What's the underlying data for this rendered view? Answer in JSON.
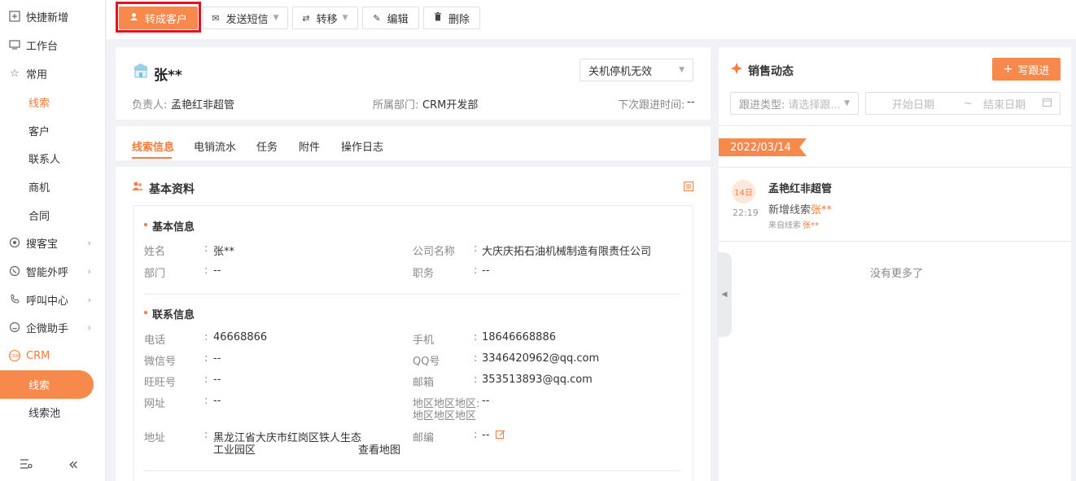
{
  "sidebar": {
    "items": [
      {
        "label": "快捷新增",
        "icon": "add-icon"
      },
      {
        "label": "工作台",
        "icon": "monitor-icon"
      },
      {
        "label": "常用",
        "icon": "star-icon"
      },
      {
        "label": "线索"
      },
      {
        "label": "客户"
      },
      {
        "label": "联系人"
      },
      {
        "label": "商机"
      },
      {
        "label": "合同"
      },
      {
        "label": "搜客宝",
        "icon": "search-icon"
      },
      {
        "label": "智能外呼",
        "icon": "phone-icon"
      },
      {
        "label": "呼叫中心",
        "icon": "call-center-icon"
      },
      {
        "label": "企微助手",
        "icon": "wechat-work-icon"
      },
      {
        "label": "CRM",
        "icon": "crm-icon"
      },
      {
        "label": "线索"
      },
      {
        "label": "线索池"
      }
    ]
  },
  "toolbar": {
    "convert": "转成客户",
    "sms": "发送短信",
    "transfer": "转移",
    "edit": "编辑",
    "delete": "删除"
  },
  "lead": {
    "name": "张**",
    "status": "关机停机无效",
    "owner_label": "负责人:",
    "owner": "孟艳红非超管",
    "dept_label": "所属部门:",
    "dept": "CRM开发部",
    "next_label": "下次跟进时间:",
    "next": "--"
  },
  "tabs": [
    "线索信息",
    "电销流水",
    "任务",
    "附件",
    "操作日志"
  ],
  "basic": {
    "title": "基本资料",
    "info_title": "基本信息",
    "name_label": "姓名",
    "name": "张**",
    "company_label": "公司名称",
    "company": "大庆庆拓石油机械制造有限责任公司",
    "dept_label": "部门",
    "dept": "--",
    "position_label": "职务",
    "position": "--",
    "contact_title": "联系信息",
    "phone_label": "电话",
    "phone": "46668866",
    "mobile_label": "手机",
    "mobile": "18646668886",
    "wechat_label": "微信号",
    "wechat": "--",
    "qq_label": "QQ号",
    "qq": "3346420962@qq.com",
    "wangwang_label": "旺旺号",
    "wangwang": "--",
    "email_label": "邮箱",
    "email": "353513893@qq.com",
    "website_label": "网址",
    "website": "--",
    "region_label_1": "地区地区地区:",
    "region_label_2": "地区地区地区",
    "region": "--",
    "address_label": "地址",
    "address_1": "黑龙江省大庆市红岗区铁人生态",
    "address_2": "工业园区",
    "map_link": "查看地图",
    "zip_label": "邮编",
    "zip": "--",
    "colon": ":"
  },
  "sales": {
    "title": "销售动态",
    "write_button": "写跟进",
    "filter_label": "跟进类型:",
    "filter_placeholder": "请选择跟...",
    "start_date": "开始日期",
    "date_sep": "~",
    "end_date": "结束日期",
    "date_tag": "2022/03/14",
    "day": "14日",
    "time": "22:19",
    "user": "孟艳红非超管",
    "action": "新增线索",
    "action_name": "张**",
    "source": "来自线索",
    "source_name": "张**",
    "no_more": "没有更多了"
  },
  "colors": {
    "accent": "#f8894d",
    "link": "#3a8ee6",
    "highlight": "#e8111b"
  }
}
